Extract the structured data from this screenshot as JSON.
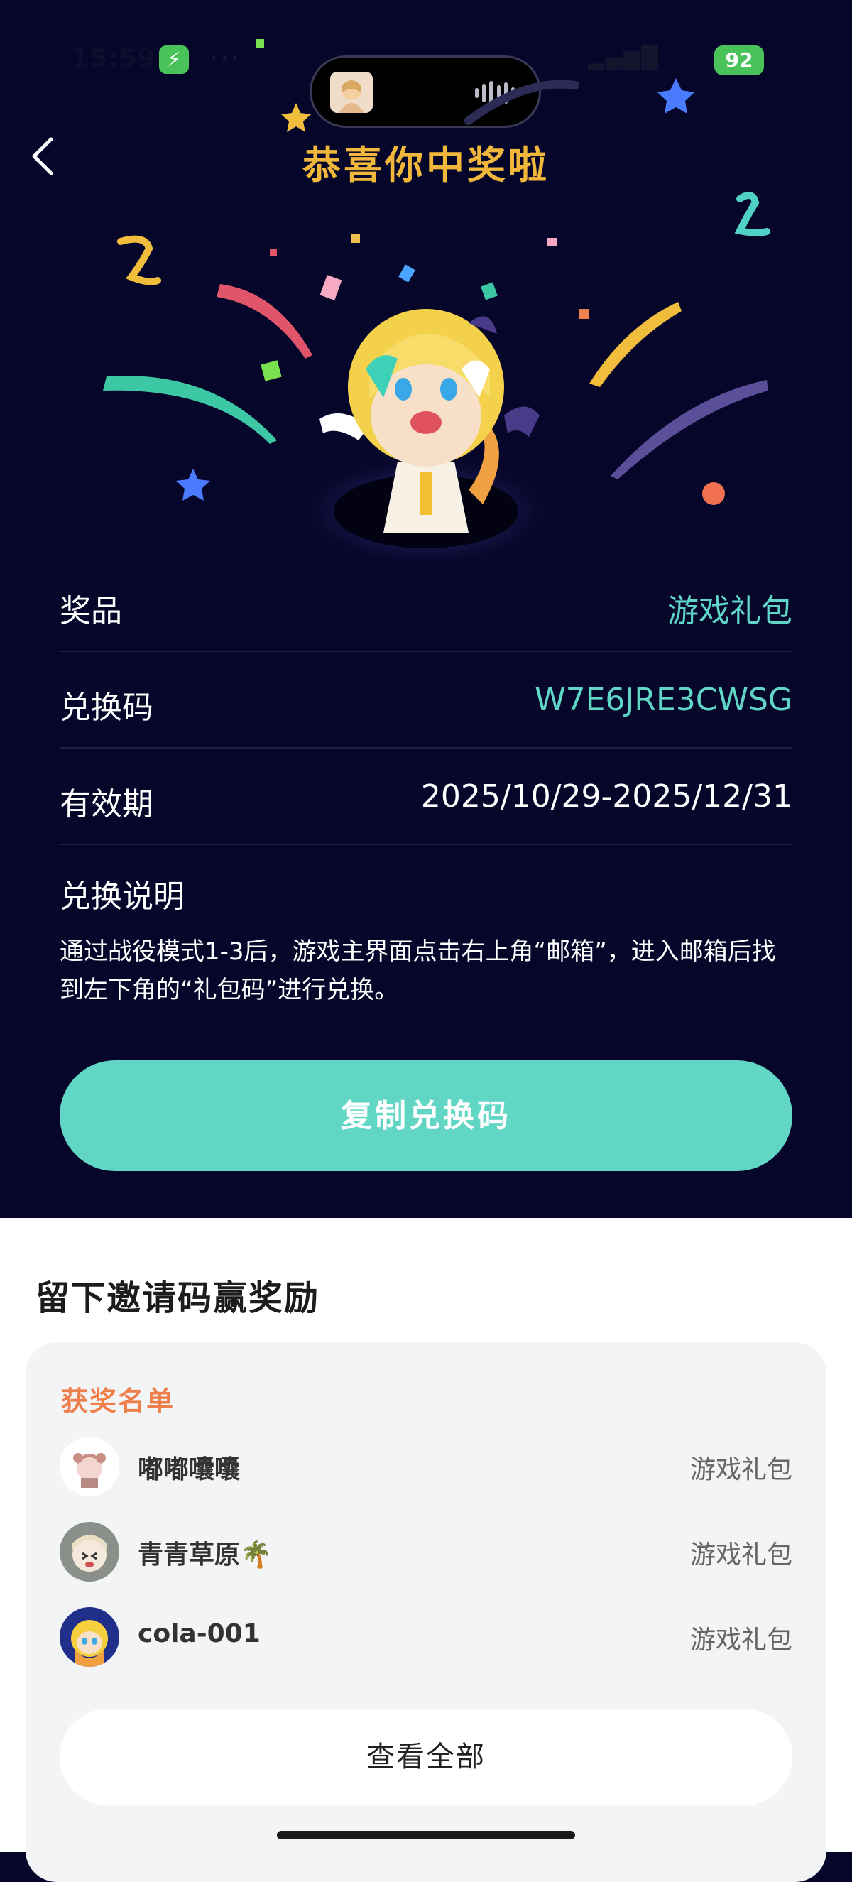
{
  "status_bar": {
    "time": "15:59",
    "battery": "92"
  },
  "header": {
    "title": "恭喜你中奖啦"
  },
  "prize_info": {
    "rows": [
      {
        "label": "奖品",
        "value": "游戏礼包"
      },
      {
        "label": "兑换码",
        "value": "W7E6JRE3CWSG"
      },
      {
        "label": "有效期",
        "value": "2025/10/29-2025/12/31"
      }
    ],
    "instructions_title": "兑换说明",
    "instructions_text": "通过战役模式1-3后，游戏主界面点击右上角“邮箱”，进入邮箱后找到左下角的“礼包码”进行兑换。"
  },
  "copy_button": {
    "label": "复制兑换码"
  },
  "invite": {
    "title": "留下邀请码赢奖励",
    "winners_title": "获奖名单",
    "winners": [
      {
        "name": "嘟嘟囔囔",
        "prize": "游戏礼包"
      },
      {
        "name": "青青草原🌴",
        "prize": "游戏礼包"
      },
      {
        "name": "cola-001",
        "prize": "游戏礼包"
      }
    ],
    "view_all_label": "查看全部"
  },
  "colors": {
    "background": "#06062a",
    "title": "#f1b73a",
    "accent": "#5fd6c6",
    "button": "#62d6c4",
    "winners_title": "#ee7f4a"
  }
}
